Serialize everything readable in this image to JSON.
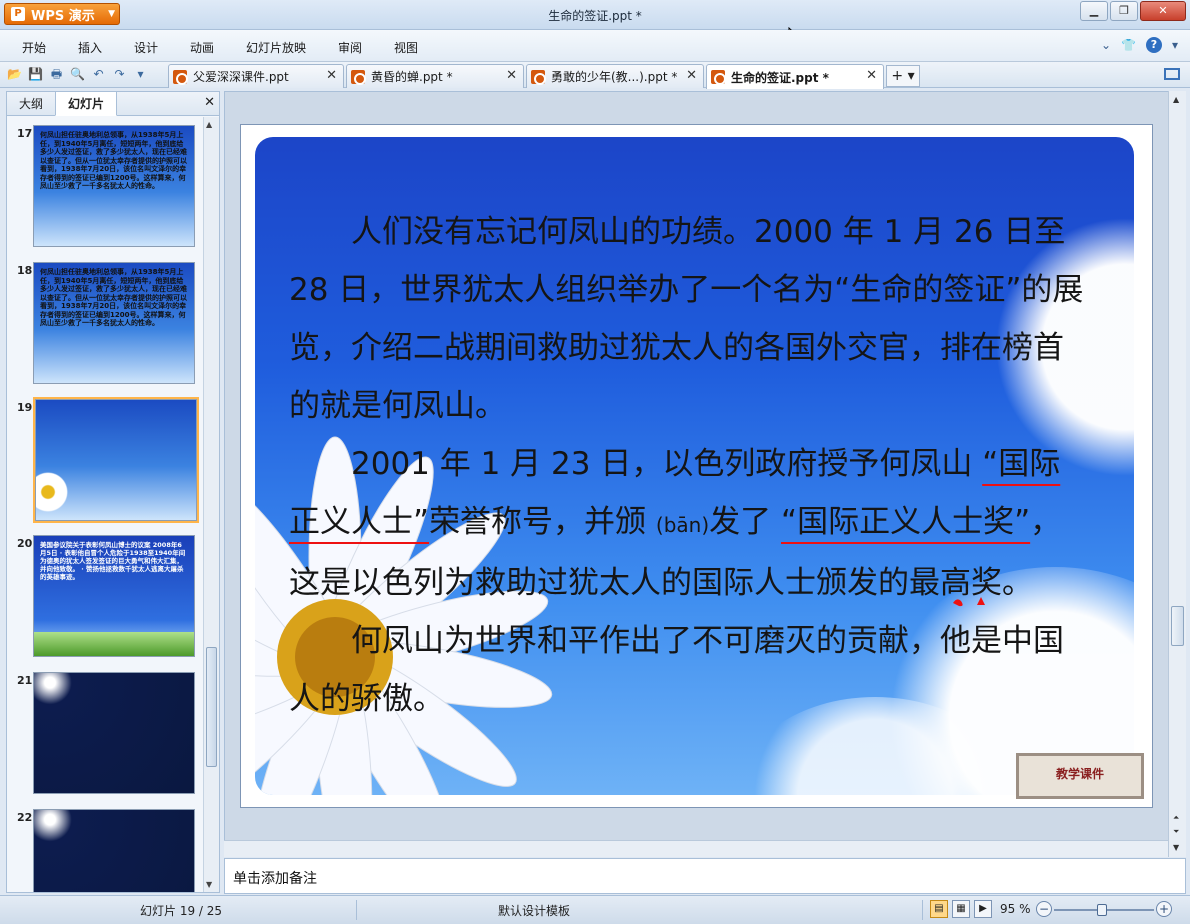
{
  "app": {
    "name": "WPS 演示",
    "window_title": "生命的签证.ppt *"
  },
  "menu": [
    "开始",
    "插入",
    "设计",
    "动画",
    "幻灯片放映",
    "审阅",
    "视图"
  ],
  "quick_access_icons": [
    "open-icon",
    "save-icon",
    "print-icon",
    "print-preview-icon",
    "undo-icon",
    "redo-icon",
    "customize-icon"
  ],
  "doc_tabs": [
    {
      "label": "父爱深深课件.ppt",
      "active": false
    },
    {
      "label": "黄昏的蝉.ppt *",
      "active": false
    },
    {
      "label": "勇敢的少年(教...).ppt *",
      "active": false
    },
    {
      "label": "生命的签证.ppt *",
      "active": true
    }
  ],
  "new_tab_label": "+",
  "left_panel": {
    "tabs": [
      "大纲",
      "幻灯片"
    ],
    "active_tab": "幻灯片",
    "thumbnails": [
      {
        "num": "17",
        "style": "sky",
        "text": "何凤山担任驻奥地利总领事，从1938年5月上任，到1940年5月离任，短短两年，他到底给多少人发过签证，救了多少犹太人，现在已经难以查证了。但从一位犹太幸存者提供的护照可以看到，1938年7月20日，该位名叫文泽尔的幸存者得到的签证已编到1200号。这样算来，何凤山至少救了一千多名犹太人的性命。"
      },
      {
        "num": "18",
        "style": "sky",
        "text": "何凤山担任驻奥地利总领事，从1938年5月上任，到1940年5月离任，短短两年，他到底给多少人发过签证，救了多少犹太人，现在已经难以查证了。但从一位犹太幸存者提供的护照可以看到，1938年7月20日，该位名叫文泽尔的幸存者得到的签证已编到1200号。这样算来，何凤山至少救了一千多名犹太人的性命。"
      },
      {
        "num": "19",
        "style": "sky-flower",
        "text": ""
      },
      {
        "num": "20",
        "style": "sky-grass",
        "text": "美国参议院关于表彰何凤山博士的议案 2008年6月5日  · 表彰他自冒个人危险于1938至1940年间为德奥的犹太人签发签证的巨大勇气和伟大汇集，并向他致敬。 · 赞扬他拯救数千犹太人逃离大屠杀的英雄事迹。"
      },
      {
        "num": "21",
        "style": "dark",
        "text": ""
      },
      {
        "num": "22",
        "style": "dark",
        "text": ""
      }
    ]
  },
  "slide": {
    "paragraph1": "人们没有忘记何凤山的功绩。2000 年 1 月 26 日至 28 日，世界犹太人组织举办了一个名为“生命的签证”的展览，介绍二战期间救助过犹太人的各国外交官，排在榜首的就是何凤山。",
    "p2_part1": "2001 年 1 月 23 日，以色列政府授予何凤山 ",
    "p2_underlined1": "“国际正义人士”",
    "p2_part2": "荣誉称号，并颁 ",
    "p2_pinyin": "(bān)",
    "p2_part3": "发了 ",
    "p2_underlined2": "“国际正义人士奖”",
    "p2_part4": "，这是以色列为救助过犹太人的国际人士颁发的最高奖。",
    "paragraph3": "何凤山为世界和平作出了不可磨灭的贡献，他是中国人的骄傲。",
    "stamp_text": "教学课件"
  },
  "notes_placeholder": "单击添加备注",
  "status": {
    "slide_position": "幻灯片 19 / 25",
    "template": "默认设计模板",
    "zoom_percent": "95 %",
    "zoom_level": 0.95
  },
  "colors": {
    "accent": "#e56a05",
    "underline": "#e11111",
    "slide_blue": "#1f5ddd"
  }
}
